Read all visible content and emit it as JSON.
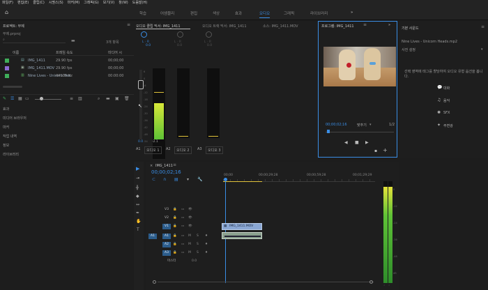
{
  "menu": [
    "파일(F)",
    "편집(E)",
    "클립(C)",
    "시퀀스(S)",
    "마커(M)",
    "그래픽(G)",
    "보기(V)",
    "창(W)",
    "도움말(H)"
  ],
  "workspaces": [
    "학습",
    "어셈블리",
    "편집",
    "색상",
    "효과",
    "오디오",
    "그래픽",
    "라이브러리"
  ],
  "workspaces_more": "»",
  "project": {
    "title": "프로젝트: 무제",
    "file": "무제.prproj",
    "count": "3개 항목",
    "col_name": "이름",
    "col_rate": "프레임 속도",
    "col_media": "미디어 시",
    "items": [
      {
        "name": "IMG_1411",
        "rate": "29.90 fps",
        "media": "00;00;00",
        "color": "#3fae5a"
      },
      {
        "name": "IMG_1411.MOV",
        "rate": "29.90 fps",
        "media": "00;00;00",
        "color": "#8e6bd4"
      },
      {
        "name": "Nine Lives - Unicorn Hea",
        "rate": "44100 Hz",
        "media": "00:00:00",
        "color": "#3fae5a"
      }
    ],
    "other_panels": [
      "효과",
      "미디어 브라우저",
      "마커",
      "작업 내역",
      "정보",
      "라이브러리"
    ]
  },
  "mixer": {
    "tab1": "오디오 클립 믹서: IMG_1411",
    "tab2": "오디오 트랙 믹서: IMG_1411",
    "tab3": "소스: IMG_1411.MOV",
    "knob_lr": "L ◦ R",
    "knob_value": "0.0",
    "fader_value": "0.0",
    "peak_value": "-2.1",
    "scale": [
      "6",
      "0",
      "-6",
      "-12",
      "-18",
      "-24",
      "-30",
      "-36",
      "-42",
      "-48",
      "-54"
    ],
    "channels": [
      {
        "id": "A1",
        "name": "오디오 1"
      },
      {
        "id": "A2",
        "name": "오디오 2"
      },
      {
        "id": "A3",
        "name": "오디오 3"
      }
    ]
  },
  "program": {
    "title": "프로그램: IMG_1411",
    "timecode": "00;00;02;16",
    "fit": "맞추기",
    "quality": "1/2"
  },
  "sound": {
    "title": "기본 사운드",
    "clip": "Nine Lives - Unicorn Heads.mp2",
    "preset": "사전 설정",
    "hint": "선택 영역에 태그를 할당하여 오디오 유형 옵션을 봅니다.",
    "buttons": [
      "대화",
      "음악",
      "SFX",
      "주변광"
    ]
  },
  "timeline": {
    "tab": "IMG_1411",
    "timecode": "00;00;02;16",
    "ruler": [
      "00;00",
      "00;00;29;28",
      "00;00;59;28",
      "00;01;29;29"
    ],
    "video_tracks": [
      "V3",
      "V2",
      "V1"
    ],
    "audio_tracks": [
      "A1",
      "A2",
      "A3"
    ],
    "source_tag": "A1",
    "master_label": "마스터",
    "master_value": "0.0",
    "clip_video": "IMG_1411.MOV",
    "meter_scale": [
      "0",
      "-12",
      "-24",
      "-36",
      "-48",
      "dB"
    ]
  },
  "colors": {
    "accent": "#3a8ee6",
    "green_label": "#3fae5a",
    "violet_label": "#8e6bd4",
    "playhead_yellow": "#e1c23a"
  }
}
